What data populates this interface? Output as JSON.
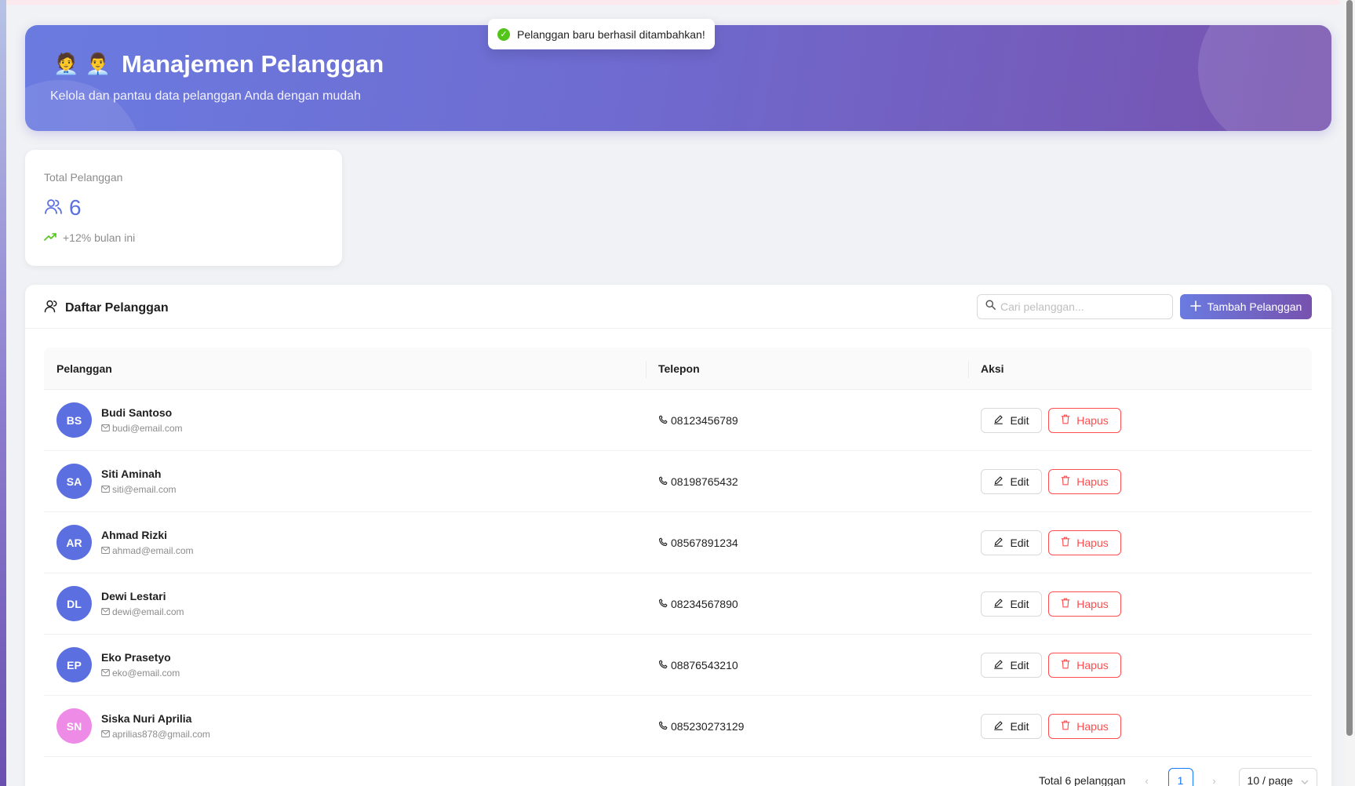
{
  "toast": {
    "message": "Pelanggan baru berhasil ditambahkan!"
  },
  "header": {
    "emoji": "🧑‍💼 👨‍💼",
    "title": "Manajemen Pelanggan",
    "subtitle": "Kelola dan pantau data pelanggan Anda dengan mudah"
  },
  "stats": {
    "label": "Total Pelanggan",
    "value": "6",
    "trend": "+12% bulan ini"
  },
  "list": {
    "title": "Daftar Pelanggan",
    "search_placeholder": "Cari pelanggan...",
    "add_label": "Tambah Pelanggan",
    "columns": [
      "Pelanggan",
      "Telepon",
      "Aksi"
    ],
    "edit_label": "Edit",
    "delete_label": "Hapus",
    "rows": [
      {
        "initials": "BS",
        "name": "Budi Santoso",
        "email": "budi@email.com",
        "phone": "08123456789",
        "avatar_color": "#5b6fe0"
      },
      {
        "initials": "SA",
        "name": "Siti Aminah",
        "email": "siti@email.com",
        "phone": "08198765432",
        "avatar_color": "#5b6fe0"
      },
      {
        "initials": "AR",
        "name": "Ahmad Rizki",
        "email": "ahmad@email.com",
        "phone": "08567891234",
        "avatar_color": "#5b6fe0"
      },
      {
        "initials": "DL",
        "name": "Dewi Lestari",
        "email": "dewi@email.com",
        "phone": "08234567890",
        "avatar_color": "#5b6fe0"
      },
      {
        "initials": "EP",
        "name": "Eko Prasetyo",
        "email": "eko@email.com",
        "phone": "08876543210",
        "avatar_color": "#5b6fe0"
      },
      {
        "initials": "SN",
        "name": "Siska Nuri Aprilia",
        "email": "aprilias878@gmail.com",
        "phone": "085230273129",
        "avatar_color": "#ee8be6"
      }
    ]
  },
  "pagination": {
    "total_text": "Total 6 pelanggan",
    "current_page": "1",
    "page_size": "10 / page"
  },
  "colors": {
    "accent": "#5b6fe0",
    "danger": "#ff4d4f",
    "success": "#52c41a"
  }
}
